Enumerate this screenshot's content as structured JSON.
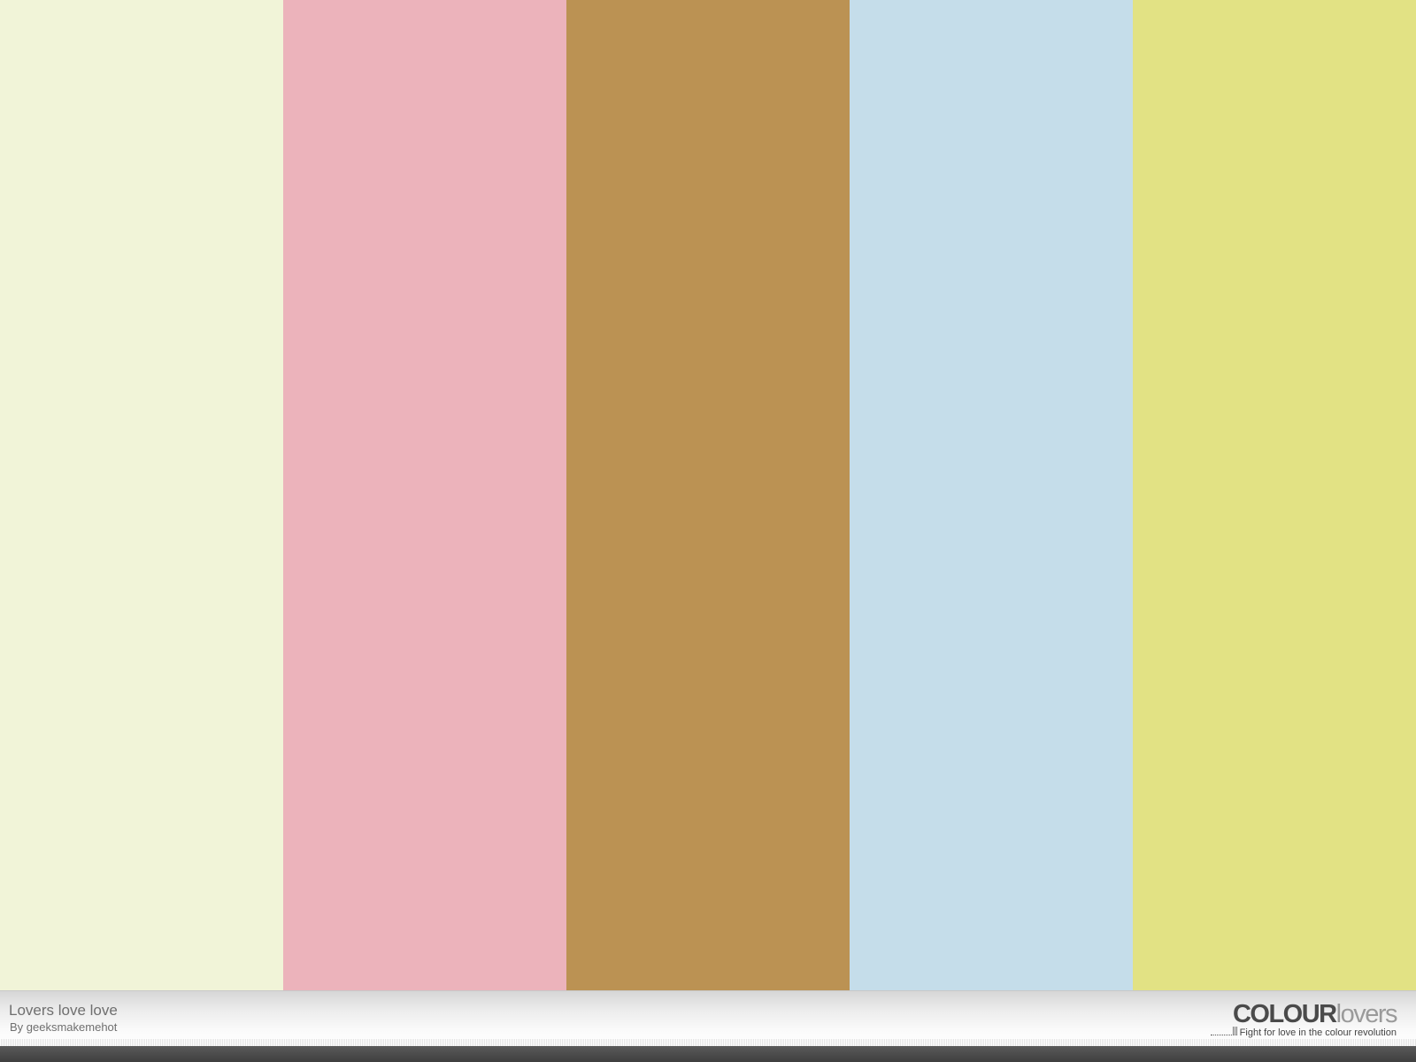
{
  "palette": {
    "title": "Lovers love love",
    "author": "By geeksmakemehot",
    "colors": [
      "#F1F4D8",
      "#ECB3BB",
      "#BB9253",
      "#C5DDEA",
      "#E2E284"
    ]
  },
  "brand": {
    "logo_bold": "COLOUR",
    "logo_light": "lovers",
    "tagline": "Fight for love in the colour revolution"
  }
}
